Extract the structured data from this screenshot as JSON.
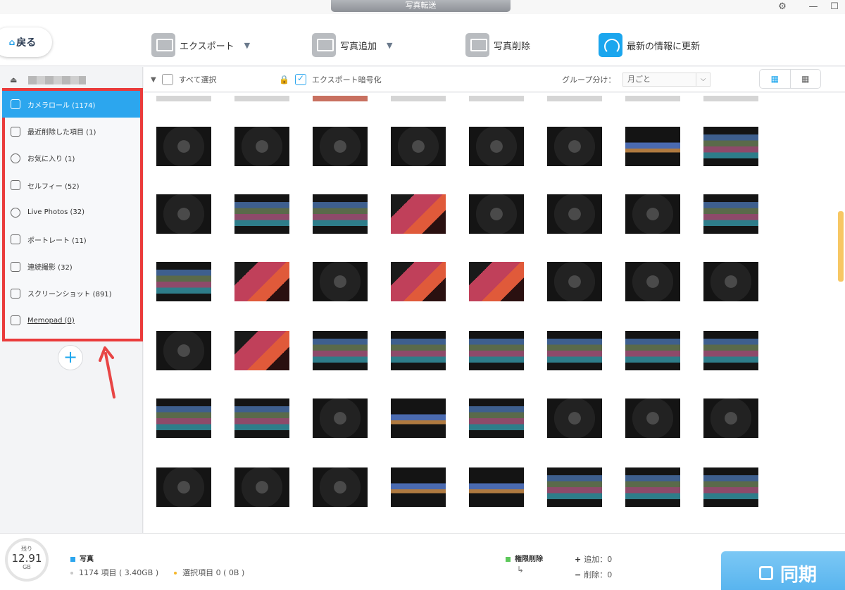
{
  "window": {
    "title": "写真転送",
    "settings_icon": "gear-icon",
    "minimize": "—",
    "maximize": "☐"
  },
  "toolbar": {
    "back_label": "戻る",
    "export_label": "エクスポート",
    "add_label": "写真追加",
    "delete_label": "写真削除",
    "refresh_label": "最新の情報に更新"
  },
  "sidebar": {
    "albums": [
      {
        "label": "カメラロール (1174)",
        "icon": "camera-icon",
        "active": true
      },
      {
        "label": "最近削除した項目 (1)",
        "icon": "trash-icon"
      },
      {
        "label": "お気に入り (1)",
        "icon": "heart-icon"
      },
      {
        "label": "セルフィー (52)",
        "icon": "selfie-icon"
      },
      {
        "label": "Live Photos (32)",
        "icon": "live-photo-icon"
      },
      {
        "label": "ポートレート (11)",
        "icon": "cube-icon"
      },
      {
        "label": "連続撮影 (32)",
        "icon": "burst-icon"
      },
      {
        "label": "スクリーンショット (891)",
        "icon": "screenshot-icon"
      },
      {
        "label": "Memopad (0)",
        "icon": "image-icon"
      }
    ],
    "add_symbol": "+"
  },
  "gridhead": {
    "select_all": "すべて選択",
    "encrypt": "エクスポート暗号化",
    "group_label": "グループ分け：",
    "group_value": "月ごと"
  },
  "bottombar": {
    "storage_label": "残り",
    "storage_value": "12.91",
    "storage_unit": "GB",
    "category_label": "写真",
    "items_text": "1174 項目 ( 3.40GB )",
    "selected_text": "選択項目 0 ( 0B )",
    "permission_delete": "権限削除",
    "add_count": "追加：0",
    "delete_count": "削除：0",
    "sync_label": "同期",
    "accent_color": "#2ca6ee",
    "legend_green": "#5cc85a"
  }
}
